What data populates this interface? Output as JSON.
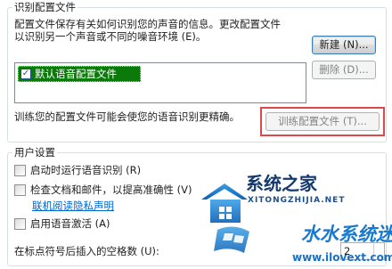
{
  "profiles_group": {
    "title": "识别配置文件",
    "description_line1": "配置文件保存有关如何识别您的声音的信息。更改配置文件",
    "description_line2": "以识别另一个声音或不同的噪音环境 (E)。",
    "new_button": "新建 (N)...",
    "delete_button": "删除 (D)...",
    "profiles": [
      {
        "label": "默认语音配置文件",
        "checked": true,
        "selected": true
      }
    ],
    "training_hint": "训练您的配置文件可能会使您的语音识别更精确。",
    "train_button": "训练配置文件 (T)..."
  },
  "user_settings_group": {
    "title": "用户设置",
    "run_at_startup_label": "启动时运行语音识别 (R)",
    "review_documents_label": "检查文档和邮件，以提高准确性 (V)",
    "privacy_link": "联机阅读隐私声明",
    "voice_activation_label": "启用语音激活 (A)",
    "spaces_label": "在标点符号后插入的空格数 (U):",
    "spaces_value": "2"
  },
  "watermark": {
    "brand_cn": "系统之家",
    "brand_pinyin": "XITONGZHIJIA.NET",
    "site_cn": "水水系统迷",
    "site_url": "www.ilovext.com"
  },
  "colors": {
    "highlight": "#e0474c",
    "list_selection": "#0b7a0b",
    "link": "#0066cc"
  }
}
